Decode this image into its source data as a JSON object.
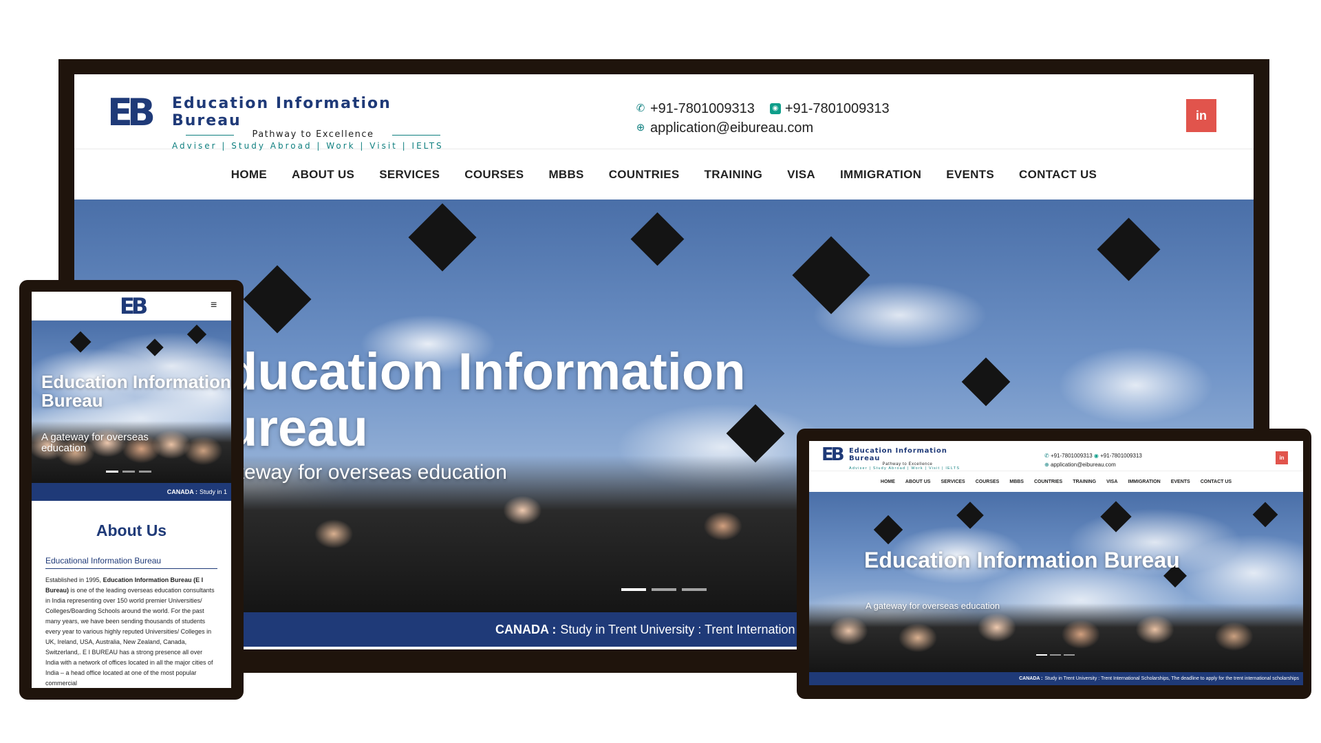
{
  "brand": {
    "logo_text": "EB",
    "name": "Education Information Bureau",
    "tagline": "Pathway to Excellence",
    "services_line": "Adviser | Study Abroad | Work | Visit | IELTS"
  },
  "contact": {
    "phone": "+91-7801009313",
    "whatsapp": "+91-7801009313",
    "email": "application@eibureau.com"
  },
  "social": {
    "linkedin_icon": "in"
  },
  "nav": {
    "items": [
      "HOME",
      "ABOUT US",
      "SERVICES",
      "COURSES",
      "MBBS",
      "COUNTRIES",
      "TRAINING",
      "VISA",
      "IMMIGRATION",
      "EVENTS",
      "CONTACT US"
    ]
  },
  "hero": {
    "desktop_title_line1": "ducation Information",
    "desktop_title_line2": "ureau",
    "desktop_subtitle": "ateway for overseas education",
    "title": "Education Information Bureau",
    "subtitle": "A gateway for overseas education",
    "slides": 3,
    "active_slide": 1
  },
  "ticker": {
    "country": "CANADA :",
    "desktop_text": "Study in Trent University : Trent Internation",
    "phone_text": "Study in 1",
    "tablet_text": "Study in Trent University : Trent International Scholarships, The deadline to apply for the trent international scholarships"
  },
  "about": {
    "title": "About Us",
    "subtitle": "Educational Information Bureau",
    "body_prefix": "Established in 1995, ",
    "body_bold": "Education Information Bureau (E I Bureau)",
    "body_rest": " is one of the leading overseas education consultants in India representing over 150 world premier Universities/ Colleges/Boarding Schools around the world. For the past many years, we have been sending thousands of students every year to various highly reputed Universities/ Colleges in UK, Ireland, USA, Australia, New Zealand, Canada, Switzerland,. E I BUREAU has a strong presence all over India with a network of offices located in all the major cities of India – a head office located at one of the most popular commercial"
  },
  "icons": {
    "phone": "phone-icon",
    "whatsapp": "whatsapp-icon",
    "globe": "globe-icon",
    "menu": "hamburger-menu-icon",
    "linkedin": "linkedin-icon"
  },
  "colors": {
    "brand_blue": "#1f3a78",
    "brand_teal": "#0e7f7f",
    "linkedin_red": "#e1544c",
    "frame": "#1f140c"
  }
}
